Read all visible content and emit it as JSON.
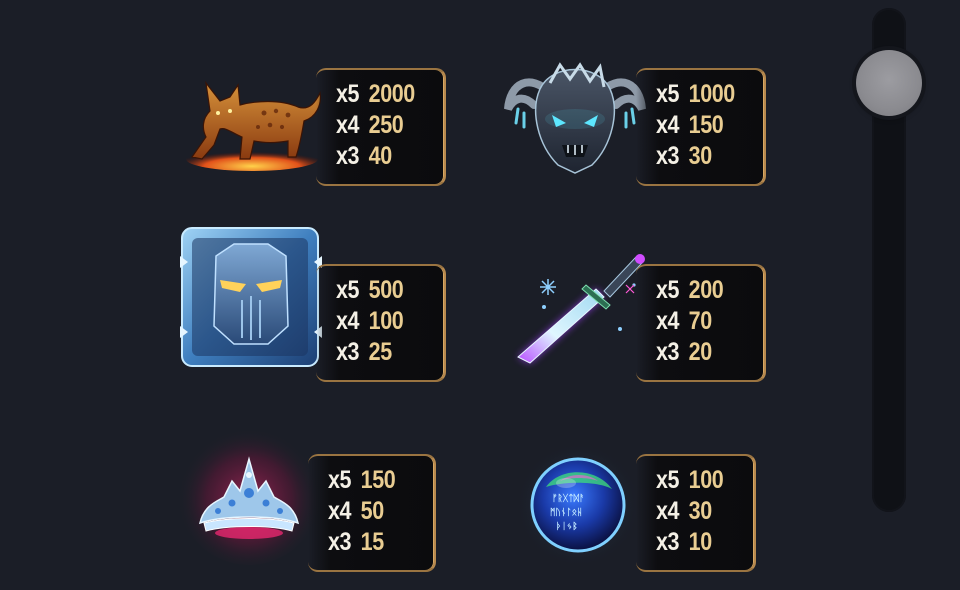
{
  "symbols": [
    {
      "name": "lynx",
      "payouts": [
        {
          "mult": "x5",
          "amount": "2000"
        },
        {
          "mult": "x4",
          "amount": "250"
        },
        {
          "mult": "x3",
          "amount": "40"
        }
      ]
    },
    {
      "name": "ice-demon",
      "payouts": [
        {
          "mult": "x5",
          "amount": "1000"
        },
        {
          "mult": "x4",
          "amount": "150"
        },
        {
          "mult": "x3",
          "amount": "30"
        }
      ]
    },
    {
      "name": "ice-helmet",
      "payouts": [
        {
          "mult": "x5",
          "amount": "500"
        },
        {
          "mult": "x4",
          "amount": "100"
        },
        {
          "mult": "x3",
          "amount": "25"
        }
      ]
    },
    {
      "name": "frost-sword",
      "payouts": [
        {
          "mult": "x5",
          "amount": "200"
        },
        {
          "mult": "x4",
          "amount": "70"
        },
        {
          "mult": "x3",
          "amount": "20"
        }
      ]
    },
    {
      "name": "ice-tiara",
      "payouts": [
        {
          "mult": "x5",
          "amount": "150"
        },
        {
          "mult": "x4",
          "amount": "50"
        },
        {
          "mult": "x3",
          "amount": "15"
        }
      ]
    },
    {
      "name": "rune-orb",
      "payouts": [
        {
          "mult": "x5",
          "amount": "100"
        },
        {
          "mult": "x4",
          "amount": "30"
        },
        {
          "mult": "x3",
          "amount": "10"
        }
      ]
    }
  ],
  "colors": {
    "background": "#1b1e27",
    "card_border": "#b8894d",
    "multiplier_text": "#f4f0e6",
    "amount_text": "#e9cd92",
    "scroll_thumb": "#8b8b90"
  }
}
